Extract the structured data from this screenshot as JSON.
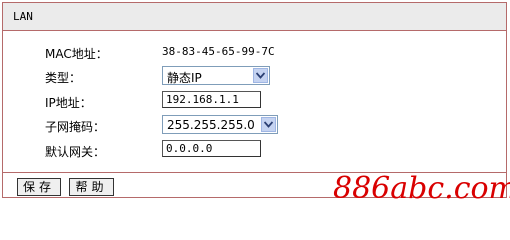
{
  "section": {
    "title": "LAN"
  },
  "fields": {
    "mac_label": "MAC地址：",
    "mac_value": "38-83-45-65-99-7C",
    "type_label": "类型：",
    "type_value": "静态IP",
    "ip_label": "IP地址：",
    "ip_value": "192.168.1.1",
    "mask_label": "子网掩码：",
    "mask_value": "255.255.255.0",
    "gateway_label": "默认网关：",
    "gateway_value": "0.0.0.0"
  },
  "buttons": {
    "save": "保存",
    "help": "帮助"
  },
  "watermark": {
    "text": "886abc.com"
  },
  "colors": {
    "border": "#b56a6a",
    "header_bg": "#ebebeb",
    "watermark": "#d90000"
  }
}
